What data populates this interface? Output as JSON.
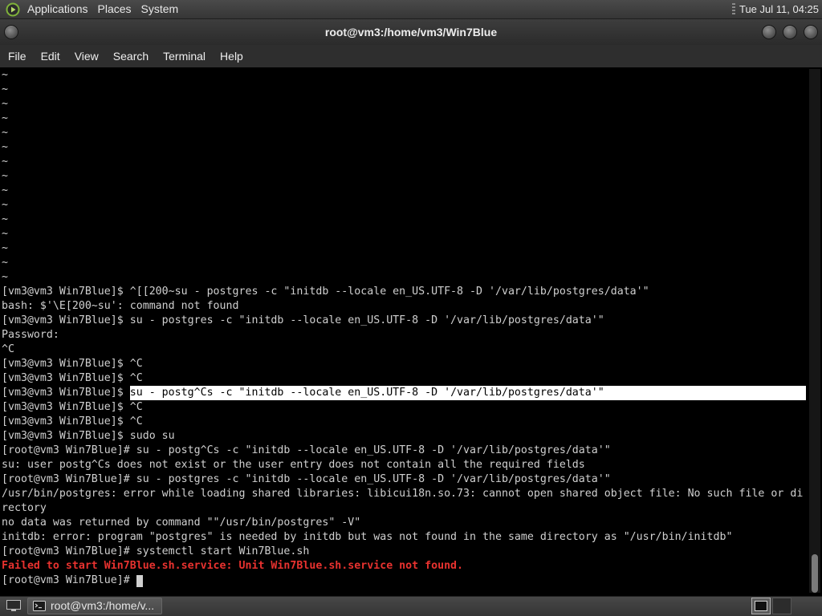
{
  "colors": {
    "terminal_bg": "#000000",
    "terminal_fg": "#d0d0d0",
    "error_fg": "#e8322f",
    "selection_bg": "#ffffff",
    "selection_fg": "#000000"
  },
  "top_panel": {
    "logo_icon": "distro-logo-icon",
    "menus": [
      {
        "label": "Applications"
      },
      {
        "label": "Places"
      },
      {
        "label": "System"
      }
    ],
    "clock": "Tue Jul 11, 04:25"
  },
  "window": {
    "title": "root@vm3:/home/vm3/Win7Blue",
    "menu_icon": "window-menu-icon",
    "controls": [
      {
        "icon": "minimize-icon"
      },
      {
        "icon": "maximize-icon"
      },
      {
        "icon": "close-icon"
      }
    ]
  },
  "menubar": {
    "items": [
      {
        "label": "File"
      },
      {
        "label": "Edit"
      },
      {
        "label": "View"
      },
      {
        "label": "Search"
      },
      {
        "label": "Terminal"
      },
      {
        "label": "Help"
      }
    ]
  },
  "terminal": {
    "scroll_position": 1.0,
    "lines": [
      {
        "segments": [
          {
            "text": "~"
          }
        ]
      },
      {
        "segments": [
          {
            "text": "~"
          }
        ]
      },
      {
        "segments": [
          {
            "text": "~"
          }
        ]
      },
      {
        "segments": [
          {
            "text": "~"
          }
        ]
      },
      {
        "segments": [
          {
            "text": "~"
          }
        ]
      },
      {
        "segments": [
          {
            "text": "~"
          }
        ]
      },
      {
        "segments": [
          {
            "text": "~"
          }
        ]
      },
      {
        "segments": [
          {
            "text": "~"
          }
        ]
      },
      {
        "segments": [
          {
            "text": "~"
          }
        ]
      },
      {
        "segments": [
          {
            "text": "~"
          }
        ]
      },
      {
        "segments": [
          {
            "text": "~"
          }
        ]
      },
      {
        "segments": [
          {
            "text": "~"
          }
        ]
      },
      {
        "segments": [
          {
            "text": "~"
          }
        ]
      },
      {
        "segments": [
          {
            "text": "~"
          }
        ]
      },
      {
        "segments": [
          {
            "text": "~"
          }
        ]
      },
      {
        "segments": [
          {
            "text": "[vm3@vm3 Win7Blue]$ ^[[200~su - postgres -c \"initdb --locale en_US.UTF-8 -D '/var/lib/postgres/data'\""
          }
        ]
      },
      {
        "segments": [
          {
            "text": "bash: $'\\E[200~su': command not found"
          }
        ]
      },
      {
        "segments": [
          {
            "text": "[vm3@vm3 Win7Blue]$ su - postgres -c \"initdb --locale en_US.UTF-8 -D '/var/lib/postgres/data'\""
          }
        ]
      },
      {
        "segments": [
          {
            "text": "Password:"
          }
        ]
      },
      {
        "segments": [
          {
            "text": "^C"
          }
        ]
      },
      {
        "segments": [
          {
            "text": "[vm3@vm3 Win7Blue]$ ^C"
          }
        ]
      },
      {
        "segments": [
          {
            "text": "[vm3@vm3 Win7Blue]$ ^C"
          }
        ]
      },
      {
        "segments": [
          {
            "text": "[vm3@vm3 Win7Blue]$ "
          },
          {
            "text": "su - postg^Cs -c \"initdb --locale en_US.UTF-8 -D '/var/lib/postgres/data'\"",
            "selected": true
          }
        ]
      },
      {
        "segments": [
          {
            "text": "[vm3@vm3 Win7Blue]$ ^C"
          }
        ]
      },
      {
        "segments": [
          {
            "text": "[vm3@vm3 Win7Blue]$ ^C"
          }
        ]
      },
      {
        "segments": [
          {
            "text": "[vm3@vm3 Win7Blue]$ sudo su"
          }
        ]
      },
      {
        "segments": [
          {
            "text": "[root@vm3 Win7Blue]# su - postg^Cs -c \"initdb --locale en_US.UTF-8 -D '/var/lib/postgres/data'\""
          }
        ]
      },
      {
        "segments": [
          {
            "text": "su: user postg^Cs does not exist or the user entry does not contain all the required fields"
          }
        ]
      },
      {
        "segments": [
          {
            "text": "[root@vm3 Win7Blue]# su - postgres -c \"initdb --locale en_US.UTF-8 -D '/var/lib/postgres/data'\""
          }
        ]
      },
      {
        "segments": [
          {
            "text": "/usr/bin/postgres: error while loading shared libraries: libicui18n.so.73: cannot open shared object file: No such file or di"
          }
        ]
      },
      {
        "segments": [
          {
            "text": "rectory"
          }
        ]
      },
      {
        "segments": [
          {
            "text": "no data was returned by command \"\"/usr/bin/postgres\" -V\""
          }
        ]
      },
      {
        "segments": [
          {
            "text": "initdb: error: program \"postgres\" is needed by initdb but was not found in the same directory as \"/usr/bin/initdb\""
          }
        ]
      },
      {
        "segments": [
          {
            "text": "[root@vm3 Win7Blue]# systemctl start Win7Blue.sh"
          }
        ]
      },
      {
        "segments": [
          {
            "text": "Failed to start Win7Blue.sh.service: Unit Win7Blue.sh.service not found.",
            "error": true
          }
        ]
      },
      {
        "segments": [
          {
            "text": "[root@vm3 Win7Blue]# "
          }
        ],
        "cursor": true
      }
    ]
  },
  "bottom_panel": {
    "show_desktop_icon": "show-desktop-icon",
    "tasks": [
      {
        "label": "root@vm3:/home/v...",
        "icon": "terminal-icon"
      }
    ],
    "workspaces": [
      {
        "active": true,
        "windows": 1
      },
      {
        "active": false,
        "windows": 0
      }
    ]
  }
}
